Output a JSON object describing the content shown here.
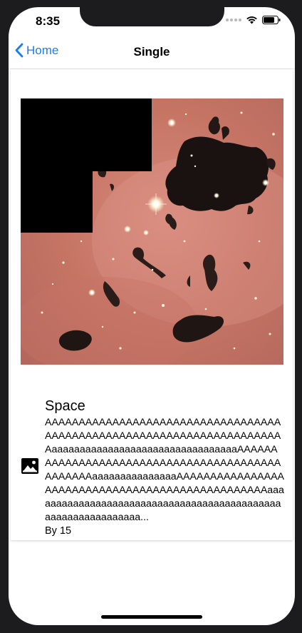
{
  "status_bar": {
    "time": "8:35"
  },
  "nav": {
    "back_label": "Home",
    "title": "Single"
  },
  "item": {
    "title": "Space",
    "description": "AAAAAAAAAAAAAAAAAAAAAAAAAAAAAAAAAAAAAAAAAAAAAAAAAAAAAAAAAAAAAAAAAAAAAAAaaaaaaaaaaaaaaaaaaaaaaaaaaaaaaaaaAAAAAAAAAAAAAAAAAAAAAAAAAAAAAAAAAAAAAAAAAAAAAAAAaaaaaaaaaaaaaaaAAAAAAAAAAAAAAAAAAAAAAAAAAAAAAAAAAAAAAAAAAAAAAAAAaaaaaaaaaaaaaaaaaaaaaaaaaaaaaaaaaaaaaaaaaaaaaaaaaaaaaaaaaaaaaa...",
    "meta": "By 15"
  },
  "icons": {
    "back": "chevron-left-icon",
    "item": "image-icon",
    "wifi": "wifi-icon",
    "battery": "battery-icon"
  },
  "colors": {
    "accent": "#1a7cf1"
  }
}
